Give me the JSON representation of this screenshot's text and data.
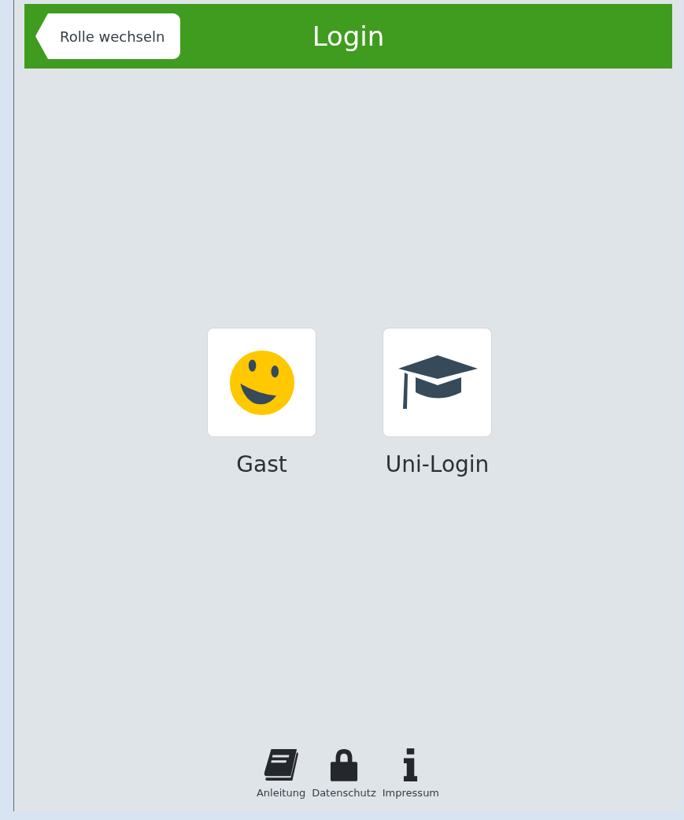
{
  "header": {
    "back_button": "Rolle wechseln",
    "title": "Login"
  },
  "tiles": [
    {
      "kind": "smiley",
      "label": "Gast"
    },
    {
      "kind": "cap",
      "label": "Uni-Login"
    }
  ],
  "footer": [
    {
      "kind": "book",
      "label": "Anleitung"
    },
    {
      "kind": "lock",
      "label": "Datenschutz"
    },
    {
      "kind": "info",
      "label": "Impressum"
    }
  ]
}
